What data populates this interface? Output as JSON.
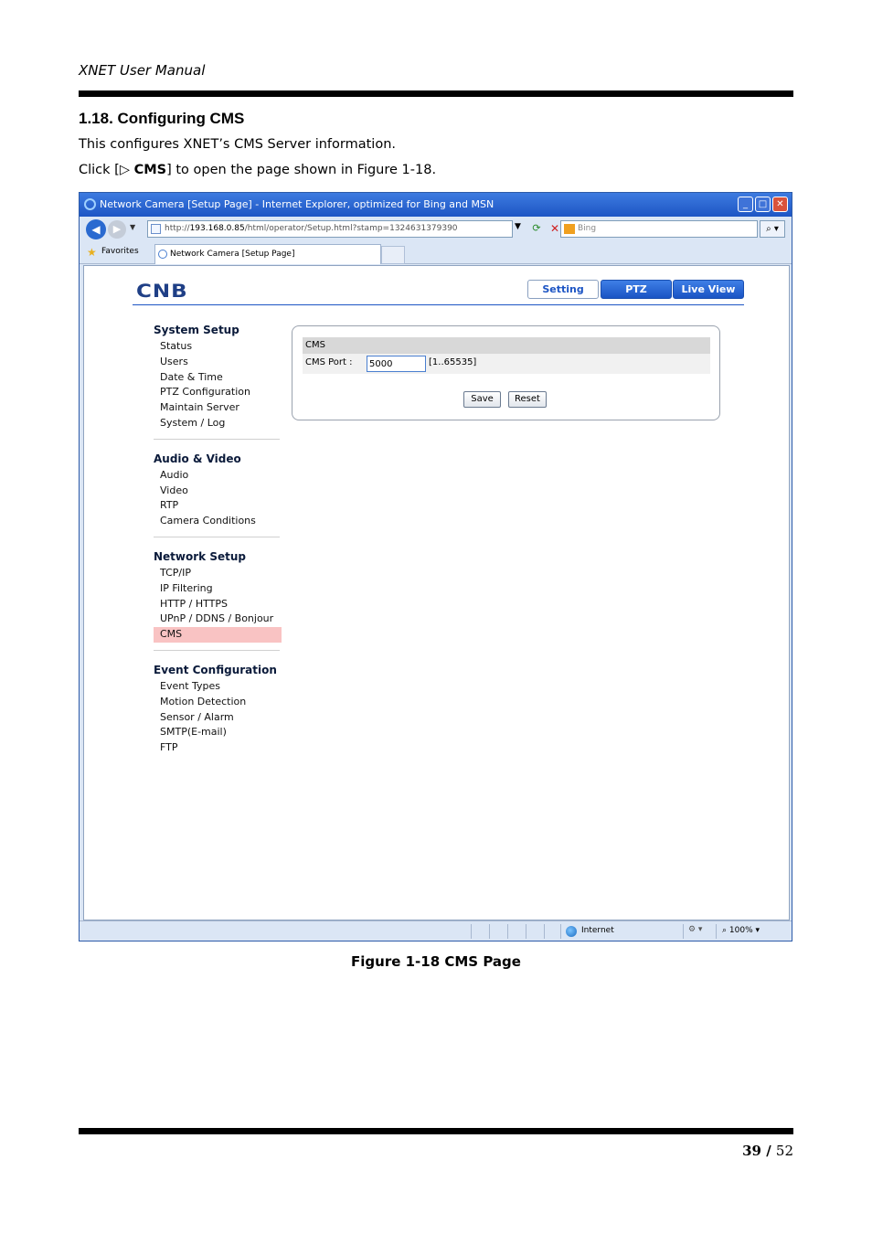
{
  "doc": {
    "header": "XNET User Manual",
    "section_title": "1.18. Configuring CMS",
    "para1": "This configures XNET’s CMS Server information.",
    "para2_prefix": "Click [",
    "para2_symbol": "▷ ",
    "para2_bold": "CMS",
    "para2_suffix": "] to open the page shown in Figure 1-18.",
    "caption": "Figure 1-18 CMS Page",
    "page_current": "39",
    "page_sep": " / ",
    "page_total": "52"
  },
  "browser": {
    "title": "Network Camera [Setup Page] - Internet Explorer, optimized for Bing and MSN",
    "address_prefix": "http://",
    "address_host": "193.168.0.85",
    "address_path": "/html/operator/Setup.html?stamp=1324631379390",
    "search_placeholder": "Bing",
    "favorites_label": "Favorites",
    "tab_label": "Network Camera [Setup Page]",
    "status_zone": "Internet",
    "status_zoom": "100%",
    "win_min": "_",
    "win_max": "□",
    "win_close": "✕"
  },
  "app": {
    "logo": "CNB",
    "buttons": {
      "setting": "Setting",
      "ptz": "PTZ",
      "live_view": "Live View"
    },
    "sidebar": [
      {
        "heading": "System Setup",
        "items": [
          "Status",
          "Users",
          "Date & Time",
          "PTZ Configuration",
          "Maintain Server",
          "System / Log"
        ]
      },
      {
        "heading": "Audio & Video",
        "items": [
          "Audio",
          "Video",
          "RTP",
          "Camera Conditions"
        ]
      },
      {
        "heading": "Network Setup",
        "items": [
          "TCP/IP",
          "IP Filtering",
          "HTTP / HTTPS",
          "UPnP / DDNS / Bonjour",
          "CMS"
        ]
      },
      {
        "heading": "Event Configuration",
        "items": [
          "Event Types",
          "Motion Detection",
          "Sensor / Alarm",
          "SMTP(E-mail)",
          "FTP"
        ]
      }
    ],
    "active_item": "CMS",
    "panel": {
      "title": "CMS",
      "port_label": "CMS Port :",
      "port_value": "5000",
      "port_range": "[1..65535]",
      "save": "Save",
      "reset": "Reset"
    }
  }
}
